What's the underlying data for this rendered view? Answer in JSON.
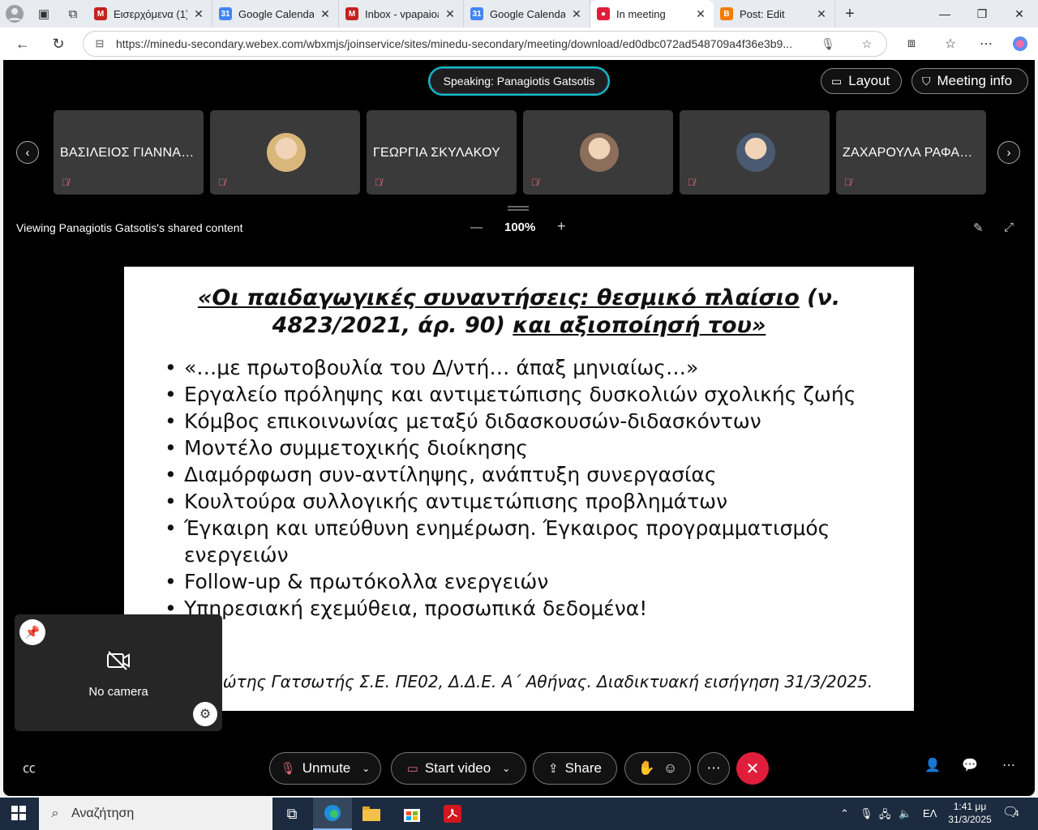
{
  "browser": {
    "tabs": [
      {
        "title": "Εισερχόμενα (1) -",
        "favicon": "gmail-icon",
        "color": "#c5221f",
        "glyph": "M"
      },
      {
        "title": "Google Calendar",
        "favicon": "calendar-icon",
        "color": "#4285f4",
        "glyph": "31"
      },
      {
        "title": "Inbox - vpapaioan",
        "favicon": "gmail-icon",
        "color": "#c5221f",
        "glyph": "M"
      },
      {
        "title": "Google Calendar",
        "favicon": "calendar-icon",
        "color": "#4285f4",
        "glyph": "31"
      },
      {
        "title": "In meeting",
        "favicon": "webex-icon",
        "color": "#e01e3c",
        "glyph": "●"
      },
      {
        "title": "Post: Edit",
        "favicon": "blogger-icon",
        "color": "#f57c00",
        "glyph": "B"
      }
    ],
    "url": "https://minedu-secondary.webex.com/wbxmjs/joinservice/sites/minedu-secondary/meeting/download/ed0dbc072ad548709a4f36e3b9..."
  },
  "meeting": {
    "speaking": "Speaking: Panagiotis Gatsotis",
    "layout_label": "Layout",
    "meeting_info_label": "Meeting info",
    "participants": [
      {
        "name": "ΒΑΣΙΛΕΙΟΣ ΓΙΑΝΝΑΚ...",
        "has_avatar": false
      },
      {
        "name": "",
        "has_avatar": true,
        "avatar_color": "#d9b77a"
      },
      {
        "name": "ΓΕΩΡΓΙΑ ΣΚΥΛΑΚΟΥ",
        "has_avatar": false
      },
      {
        "name": "",
        "has_avatar": true,
        "avatar_color": "#8d6e5a"
      },
      {
        "name": "",
        "has_avatar": true,
        "avatar_color": "#4a5a70"
      },
      {
        "name": "ΖΑΧΑΡΟΥΛΑ ΡΑΦΑΗ...",
        "has_avatar": false
      }
    ],
    "viewing_text": "Viewing Panagiotis Gatsotis's shared content",
    "zoom": "100%",
    "self_view": {
      "no_camera": "No camera"
    },
    "controls": {
      "unmute": "Unmute",
      "start_video": "Start video",
      "share": "Share"
    }
  },
  "slide": {
    "title_part1": "«Οι παιδαγωγικές συναντήσεις: θεσμικό πλαίσιο",
    "title_part2": " (ν. 4823/2021, άρ. 90) ",
    "title_part3": "και αξιοποίησή του»",
    "bullets": [
      "«…με πρωτοβουλία του Δ/ντή… άπαξ μηνιαίως…»",
      "Εργαλείο πρόληψης και αντιμετώπισης δυσκολιών σχολικής ζωής",
      "Κόμβος επικοινωνίας μεταξύ διδασκουσών-διδασκόντων",
      "Μοντέλο συμμετοχικής διοίκησης",
      "Διαμόρφωση συν-αντίληψης, ανάπτυξη συνεργασίας",
      "Κουλτούρα συλλογικής αντιμετώπισης προβλημάτων",
      "Έγκαιρη και υπεύθυνη ενημέρωση. Έγκαιρος προγραμματισμός ενεργειών",
      "Follow-up & πρωτόκολλα ενεργειών",
      "Υπηρεσιακή εχεμύθεια, προσωπικά δεδομένα!"
    ],
    "footer": "Παναγιώτης Γατσωτής Σ.Ε. ΠΕ02, Δ.Δ.Ε. Α΄ Αθήνας. Διαδικτυακή εισήγηση 31/3/2025."
  },
  "taskbar": {
    "search_placeholder": "Αναζήτηση",
    "language": "ΕΛ",
    "time": "1:41 μμ",
    "date": "31/3/2025",
    "notifications": "4"
  }
}
